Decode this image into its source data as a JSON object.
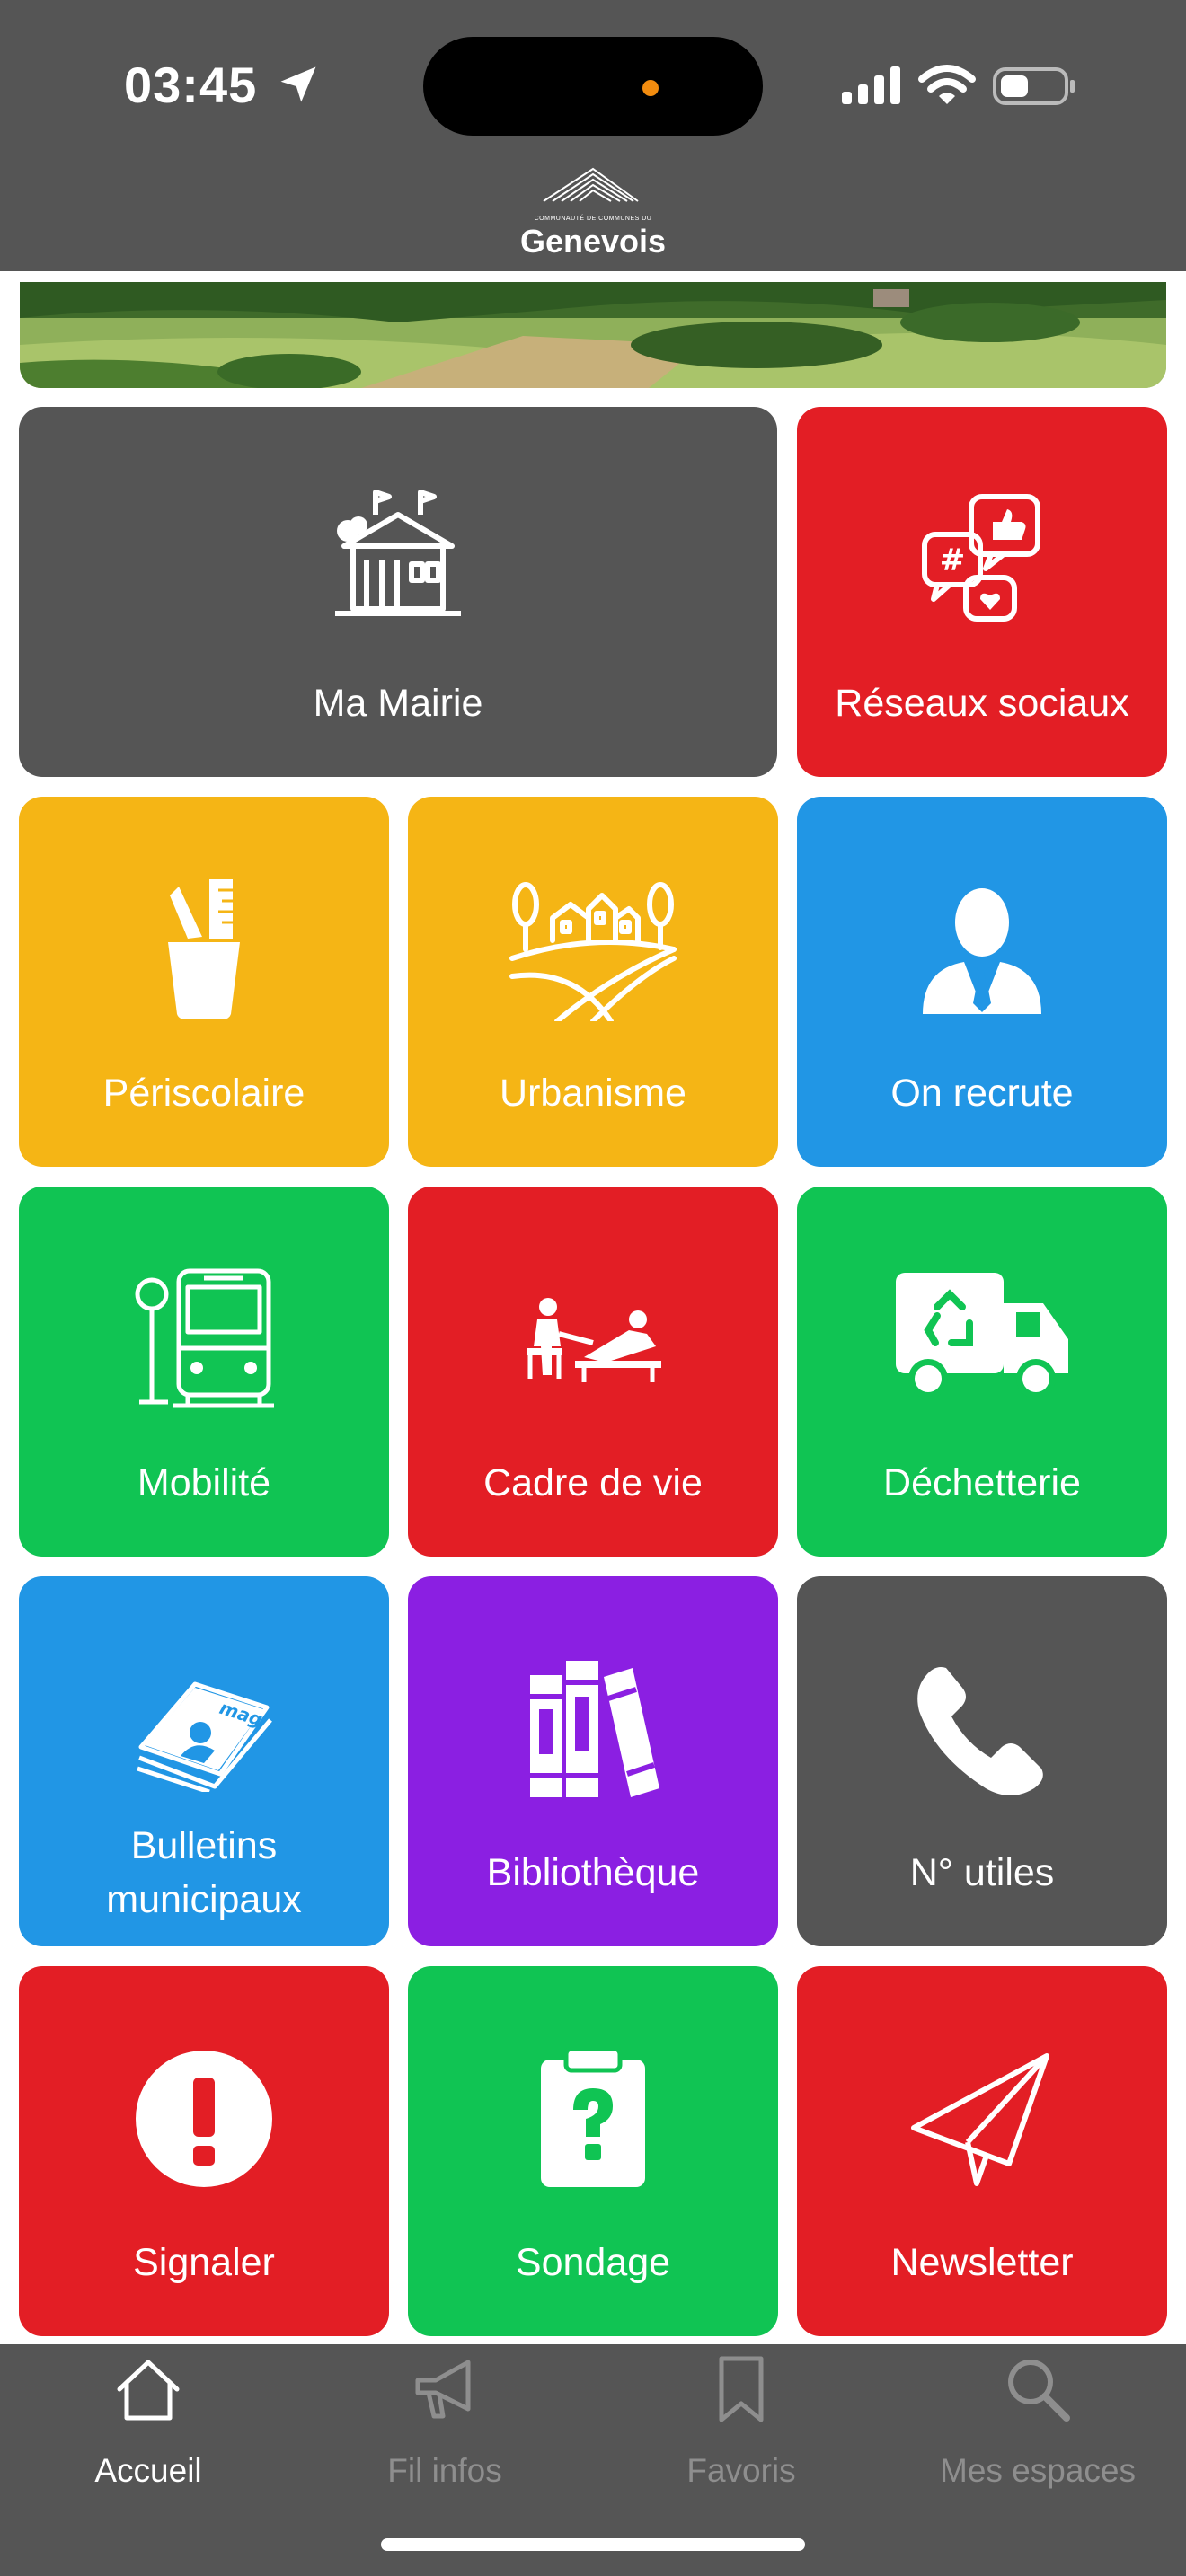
{
  "status_bar": {
    "time": "03:45"
  },
  "header": {
    "logo_subtitle": "COMMUNAUTÉ DE COMMUNES DU",
    "logo_name": "Genevois"
  },
  "tiles": [
    {
      "label": "Ma Mairie",
      "icon": "town-hall-icon",
      "color": "#555555"
    },
    {
      "label": "Réseaux sociaux",
      "icon": "social-bubbles-icon",
      "color": "#e31e25"
    },
    {
      "label": "Périscolaire",
      "icon": "pencil-cup-icon",
      "color": "#f5b515"
    },
    {
      "label": "Urbanisme",
      "icon": "village-landscape-icon",
      "color": "#f5b515"
    },
    {
      "label": "On recrute",
      "icon": "businessman-icon",
      "color": "#2196e5"
    },
    {
      "label": "Mobilité",
      "icon": "bus-stop-icon",
      "color": "#10c453"
    },
    {
      "label": "Cadre de vie",
      "icon": "care-massage-icon",
      "color": "#e31e25"
    },
    {
      "label": "Déchetterie",
      "icon": "recycling-truck-icon",
      "color": "#10c453"
    },
    {
      "label": "Bulletins\nmunicipaux",
      "label_line1": "Bulletins",
      "label_line2": "municipaux",
      "icon": "magazine-icon",
      "color": "#2196e5"
    },
    {
      "label": "Bibliothèque",
      "icon": "books-icon",
      "color": "#8b1fe2"
    },
    {
      "label": "N° utiles",
      "icon": "phone-icon",
      "color": "#555555"
    },
    {
      "label": "Signaler",
      "icon": "exclamation-icon",
      "color": "#e31e25"
    },
    {
      "label": "Sondage",
      "icon": "question-clipboard-icon",
      "color": "#10c453"
    },
    {
      "label": "Newsletter",
      "icon": "paper-plane-icon",
      "color": "#e31e25"
    }
  ],
  "tabbar": {
    "items": [
      {
        "label": "Accueil",
        "icon": "home-icon",
        "active": true
      },
      {
        "label": "Fil infos",
        "icon": "megaphone-icon",
        "active": false
      },
      {
        "label": "Favoris",
        "icon": "bookmark-icon",
        "active": false
      },
      {
        "label": "Mes espaces",
        "icon": "search-icon",
        "active": false
      }
    ]
  }
}
